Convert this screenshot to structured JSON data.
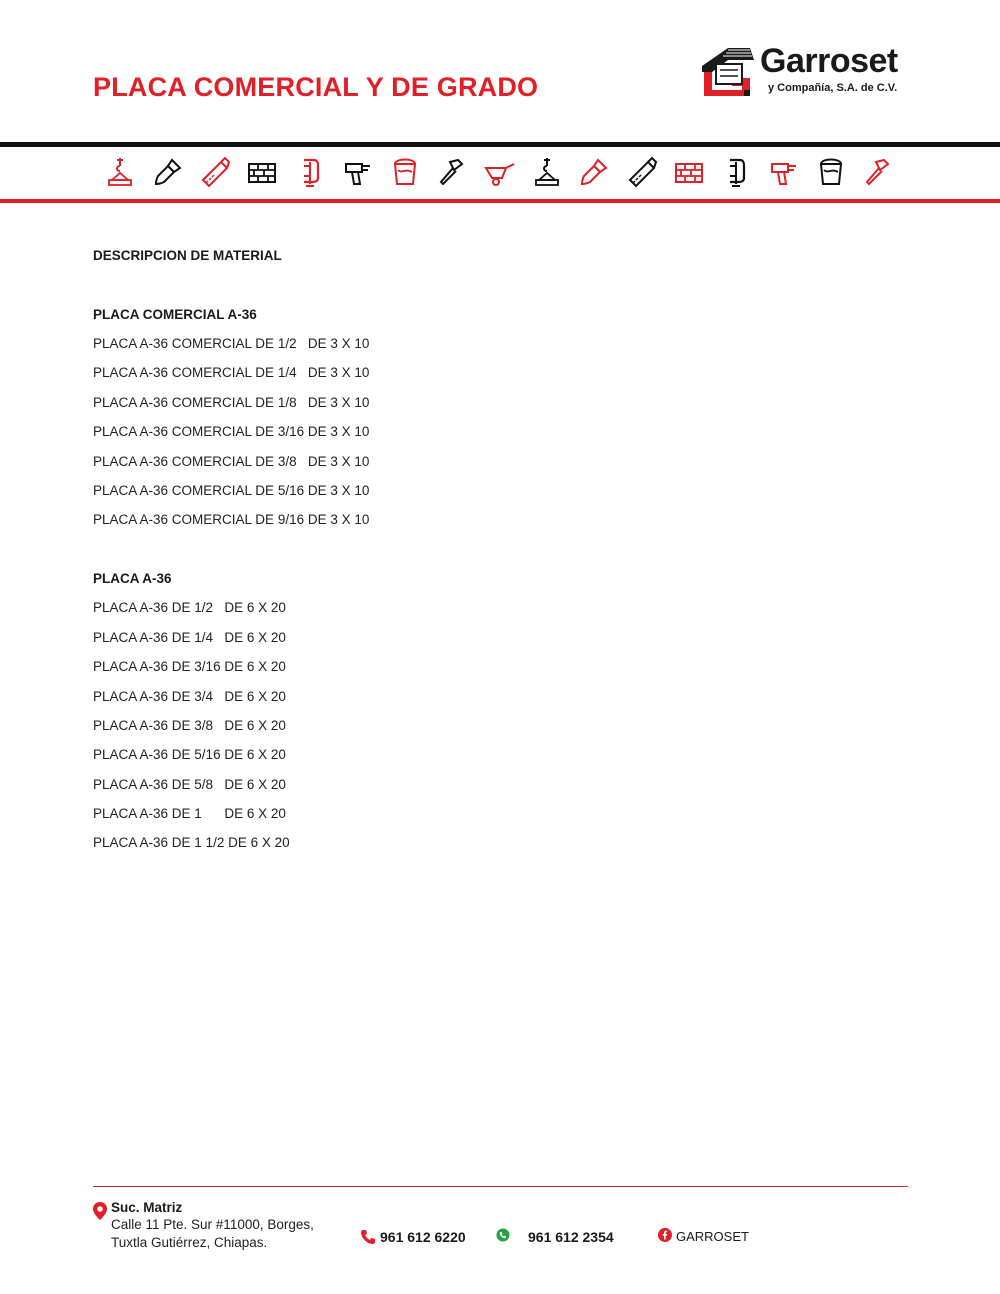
{
  "header": {
    "title": "PLACA COMERCIAL Y DE GRADO",
    "logo_name": "Garroset",
    "logo_tagline": "y Compañía, S.A. de C.V."
  },
  "colors": {
    "accent": "#e01f26",
    "dark": "#111111",
    "whatsapp": "#25a244"
  },
  "tool_icons": [
    "crane-hook-icon",
    "paint-brush-icon",
    "hand-saw-icon",
    "bricks-icon",
    "clamp-icon",
    "drill-icon",
    "paint-bucket-icon",
    "hammer-icon",
    "wheelbarrow-icon",
    "crane-hook-icon",
    "paint-brush-icon",
    "hand-saw-icon",
    "bricks-icon",
    "clamp-icon",
    "drill-icon",
    "paint-bucket-icon",
    "hammer-icon"
  ],
  "content": {
    "heading": "DESCRIPCION DE MATERIAL",
    "sections": [
      {
        "title": "PLACA COMERCIAL A-36",
        "items": [
          "PLACA A-36 COMERCIAL DE 1/2   DE 3 X 10",
          "PLACA A-36 COMERCIAL DE 1/4   DE 3 X 10",
          "PLACA A-36 COMERCIAL DE 1/8   DE 3 X 10",
          "PLACA A-36 COMERCIAL DE 3/16 DE 3 X 10",
          "PLACA A-36 COMERCIAL DE 3/8   DE 3 X 10",
          "PLACA A-36 COMERCIAL DE 5/16 DE 3 X 10",
          "PLACA A-36 COMERCIAL DE 9/16 DE 3 X 10"
        ]
      },
      {
        "title": "PLACA A-36",
        "items": [
          "PLACA A-36 DE 1/2   DE 6 X 20",
          "PLACA A-36 DE 1/4   DE 6 X 20",
          "PLACA A-36 DE 3/16 DE 6 X 20",
          "PLACA A-36 DE 3/4   DE 6 X 20",
          "PLACA A-36 DE 3/8   DE 6 X 20",
          "PLACA A-36 DE 5/16 DE 6 X 20",
          "PLACA A-36 DE 5/8   DE 6 X 20",
          "PLACA A-36 DE 1      DE 6 X 20",
          "PLACA A-36 DE 1 1/2 DE 6 X 20"
        ]
      }
    ]
  },
  "footer": {
    "branch": "Suc. Matriz",
    "address_line1": "Calle 11 Pte. Sur #11000, Borges,",
    "address_line2": "Tuxtla Gutiérrez, Chiapas.",
    "phone": "961 612 6220",
    "whatsapp": "961 612 2354",
    "facebook": "GARROSET"
  }
}
